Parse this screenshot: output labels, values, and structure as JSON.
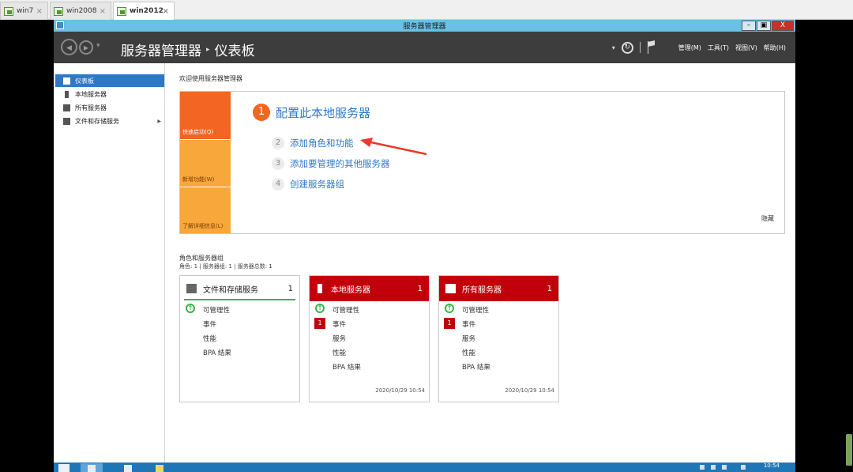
{
  "host_tabs": [
    {
      "label": "win7"
    },
    {
      "label": "win2008"
    },
    {
      "label": "win2012"
    }
  ],
  "window": {
    "title": "服务器管理器",
    "minimize": "–",
    "restore": "🗗",
    "close": "X"
  },
  "header": {
    "back": "◀",
    "forward": "▶",
    "app_title": "服务器管理器",
    "separator": "▸",
    "page_title": "仪表板",
    "menu_manage": "管理(M)",
    "menu_tools": "工具(T)",
    "menu_view": "视图(V)",
    "menu_help": "帮助(H)"
  },
  "sidebar": {
    "items": [
      {
        "label": "仪表板",
        "active": true
      },
      {
        "label": "本地服务器"
      },
      {
        "label": "所有服务器"
      },
      {
        "label": "文件和存储服务",
        "has_children": true
      }
    ]
  },
  "welcome": "欢迎使用服务器管理器",
  "quick_start": {
    "seg1": "快速启动(Q)",
    "seg2": "新增功能(W)",
    "seg3": "了解详细信息(L)",
    "step1_num": "1",
    "step1": "配置此本地服务器",
    "step2_num": "2",
    "step2": "添加角色和功能",
    "step3_num": "3",
    "step3": "添加要管理的其他服务器",
    "step4_num": "4",
    "step4": "创建服务器组",
    "hide": "隐藏"
  },
  "roles": {
    "title": "角色和服务器组",
    "subtitle": "角色: 1 | 服务器组: 1 | 服务器总数: 1",
    "tiles": [
      {
        "name": "文件和存储服务",
        "count": "1",
        "rows": [
          "可管理性",
          "事件",
          "性能",
          "BPA 结果"
        ],
        "time": ""
      },
      {
        "name": "本地服务器",
        "count": "1",
        "rows": [
          "可管理性",
          "事件",
          "服务",
          "性能",
          "BPA 结果"
        ],
        "event_badge": "1",
        "time": "2020/10/29 10:54"
      },
      {
        "name": "所有服务器",
        "count": "1",
        "rows": [
          "可管理性",
          "事件",
          "服务",
          "性能",
          "BPA 结果"
        ],
        "event_badge": "1",
        "time": "2020/10/29 10:54"
      }
    ]
  },
  "taskbar": {
    "clock": "10:54"
  },
  "colors": {
    "header_bg": "#3d3d3d",
    "accent_blue": "#2e79c7",
    "orange": "#f26522",
    "light_orange": "#f8a73b",
    "tile_red": "#c2000b",
    "ok_green": "#39b54a",
    "taskbar": "#1f76b6"
  },
  "icons": [
    "vm-icon",
    "back-icon",
    "forward-icon",
    "refresh-icon",
    "flag-icon",
    "dashboard-icon",
    "server-icon",
    "servers-icon",
    "storage-icon",
    "ok-status-icon",
    "annotation-arrow"
  ]
}
